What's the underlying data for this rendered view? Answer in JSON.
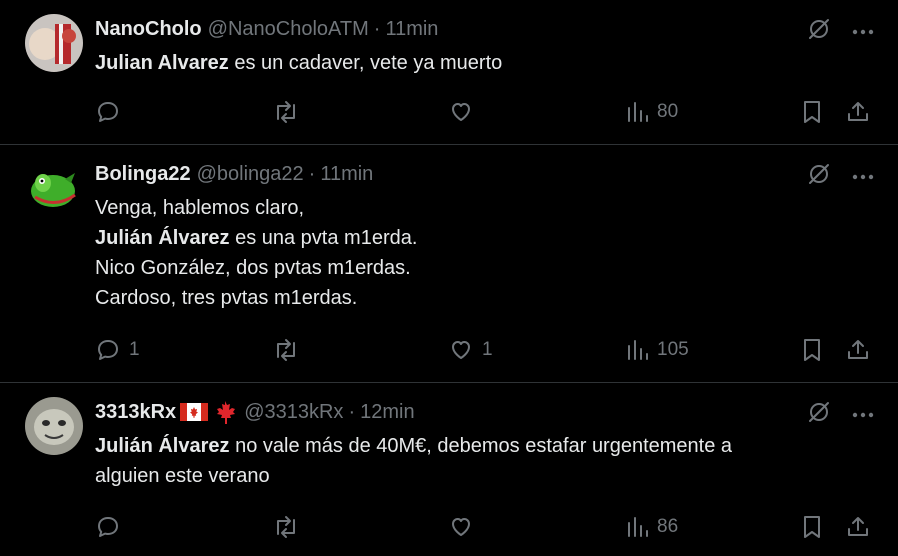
{
  "tweets": [
    {
      "name": "NanoCholo",
      "handle": "@NanoCholoATM",
      "separator": "·",
      "time": "11min",
      "lines": [
        {
          "bold": "Julian Alvarez",
          "text": " es un cadaver, vete ya muerto"
        }
      ],
      "replies": "",
      "retweets": "",
      "likes": "",
      "views": "80"
    },
    {
      "name": "Bolinga22",
      "handle": "@bolinga22",
      "separator": "·",
      "time": "11min",
      "lines": [
        {
          "bold": "",
          "text": "Venga, hablemos claro,"
        },
        {
          "bold": "Julián Álvarez",
          "text": " es una pvta m1erda."
        },
        {
          "bold": "",
          "text": "Nico González, dos pvtas m1erdas."
        },
        {
          "bold": "",
          "text": "Cardoso, tres pvtas m1erdas."
        }
      ],
      "replies": "1",
      "retweets": "",
      "likes": "1",
      "views": "105"
    },
    {
      "name": "3313kRx",
      "handle": "@3313kRx",
      "separator": "·",
      "time": "12min",
      "lines": [
        {
          "bold": "Julián Álvarez",
          "text": " no vale más de 40M€, debemos estafar urgentemente a"
        },
        {
          "bold": "",
          "text": "alguien este verano"
        }
      ],
      "replies": "",
      "retweets": "",
      "likes": "",
      "views": "86"
    }
  ],
  "colors": {
    "background": "#000000",
    "text": "#e7e9ea",
    "muted": "#71767b",
    "border": "#2f3336"
  }
}
